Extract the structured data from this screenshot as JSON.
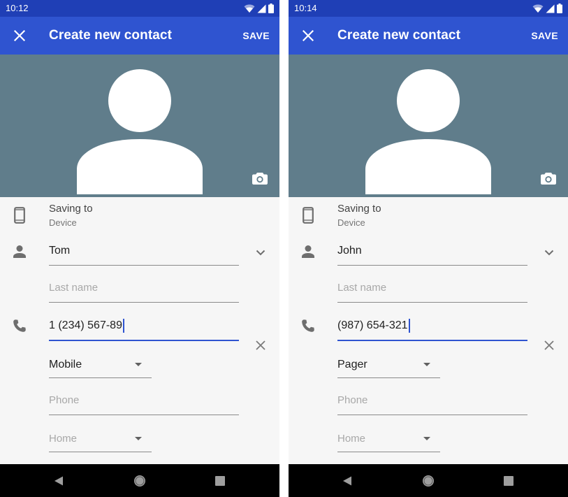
{
  "screens": [
    {
      "status_time": "10:12",
      "app_title": "Create new contact",
      "save_label": "SAVE",
      "saving_to_label": "Saving to",
      "saving_to_value": "Device",
      "first_name_value": "Tom",
      "last_name_placeholder": "Last name",
      "phone_value": "1 (234) 567-89",
      "phone_type": "Mobile",
      "phone2_placeholder": "Phone",
      "phone2_type": "Home"
    },
    {
      "status_time": "10:14",
      "app_title": "Create new contact",
      "save_label": "SAVE",
      "saving_to_label": "Saving to",
      "saving_to_value": "Device",
      "first_name_value": "John",
      "last_name_placeholder": "Last name",
      "phone_value": "(987) 654-321",
      "phone_type": "Pager",
      "phone2_placeholder": "Phone",
      "phone2_type": "Home"
    }
  ],
  "icons": {
    "close": "close-icon",
    "camera": "camera-icon",
    "device": "smartphone-icon",
    "person": "person-icon",
    "phone": "phone-icon",
    "expand": "chevron-down-icon",
    "clear": "clear-icon",
    "wifi": "wifi-icon",
    "signal": "signal-icon",
    "battery": "battery-icon",
    "back": "back-icon",
    "home": "home-icon",
    "recents": "recents-icon"
  },
  "colors": {
    "status_bar": "#1f3fb6",
    "app_bar": "#2f54d0",
    "photo_background": "#607d8b",
    "form_background": "#f6f6f6",
    "accent": "#2f54d0",
    "nav_bar": "#000000"
  }
}
